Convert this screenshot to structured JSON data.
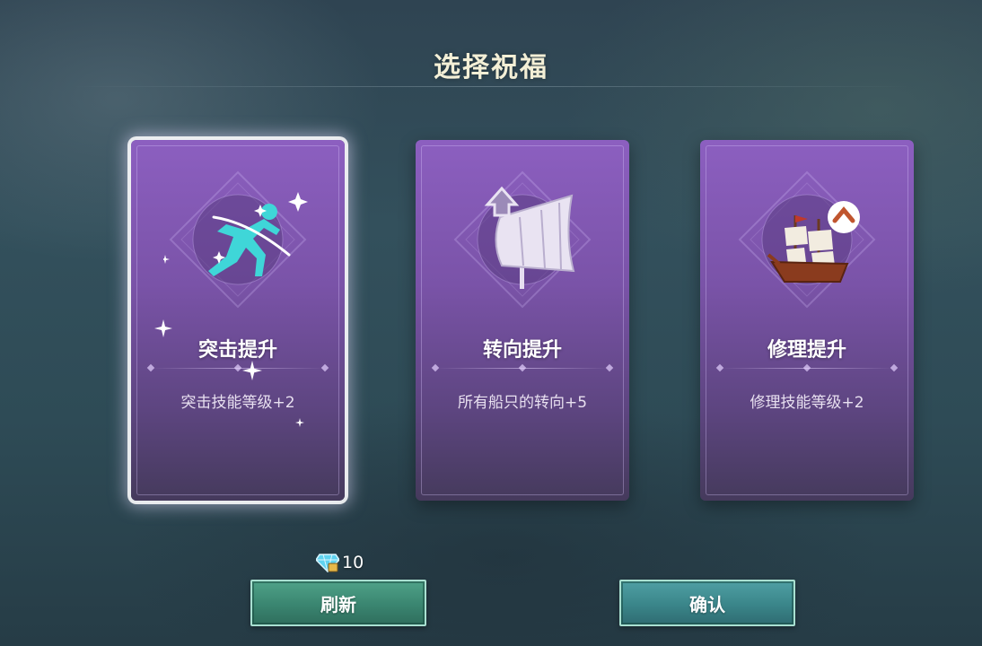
{
  "header": {
    "title": "选择祝福"
  },
  "cards": [
    {
      "name": "突击提升",
      "desc": "突击技能等级+2",
      "icon": "running-figure-icon",
      "selected": true
    },
    {
      "name": "转向提升",
      "desc": "所有船只的转向+5",
      "icon": "sail-arrow-icon",
      "selected": false
    },
    {
      "name": "修理提升",
      "desc": "修理技能等级+2",
      "icon": "repair-ship-icon",
      "selected": false
    }
  ],
  "refresh": {
    "cost": "10",
    "cost_icon": "diamond-icon",
    "label": "刷新"
  },
  "confirm": {
    "label": "确认"
  },
  "colors": {
    "card_top": "#8c5fc0",
    "card_bottom": "#453a5c",
    "button_refresh": "#3a8570",
    "button_confirm": "#3a8589",
    "title": "#f3efd6",
    "icon_cyan": "#3fd6d8"
  }
}
